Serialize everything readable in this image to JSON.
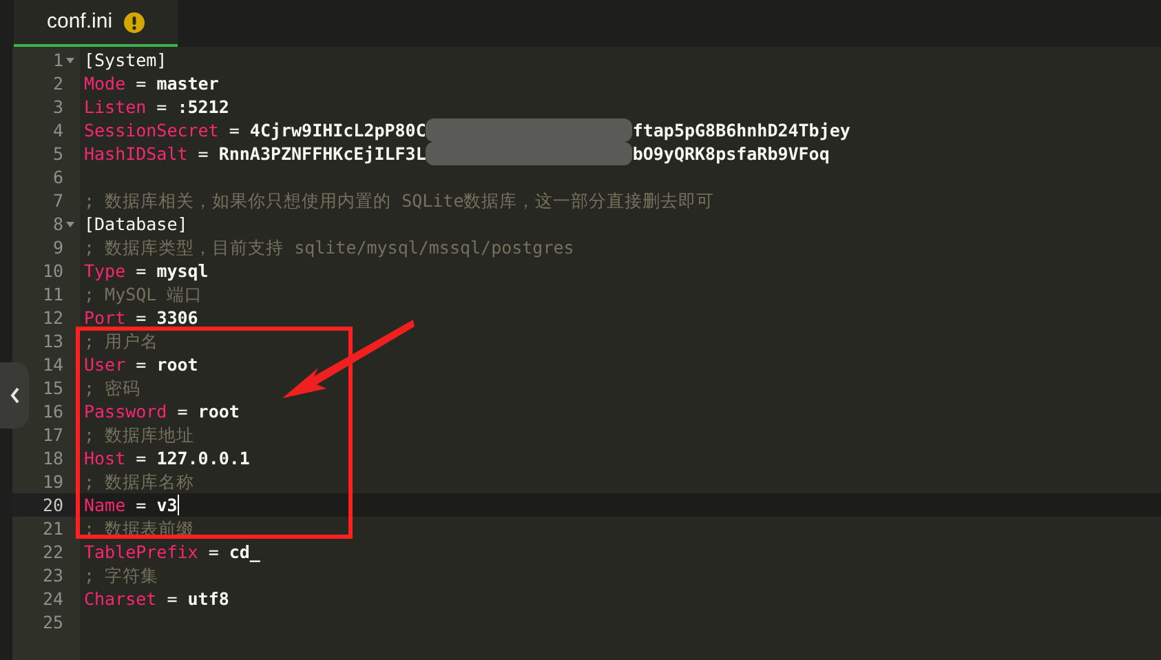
{
  "tabs": [
    {
      "label": "conf.ini",
      "selected": true,
      "warning": true
    }
  ],
  "lines": [
    {
      "number": "1",
      "kind": "section",
      "text": "[System]",
      "foldable": true,
      "active": false
    },
    {
      "number": "2",
      "kind": "pair",
      "key": "Mode",
      "sep": " = ",
      "value": "master",
      "active": false
    },
    {
      "number": "3",
      "kind": "pair",
      "key": "Listen",
      "sep": " = ",
      "value": ":5212",
      "active": false
    },
    {
      "number": "4",
      "kind": "pair",
      "key": "SessionSecret",
      "sep": " = ",
      "value": "4Cjrw9IHIcL2pP80C",
      "redacted": true,
      "value_after": "ftap5pG8B6hnhD24Tbjey",
      "active": false
    },
    {
      "number": "5",
      "kind": "pair",
      "key": "HashIDSalt",
      "sep": " = ",
      "value": "RnnA3PZNFFHKcEjILF3L",
      "redacted": true,
      "value_after": "bO9yQRK8psfaRb9VFoq",
      "active": false
    },
    {
      "number": "6",
      "kind": "blank",
      "active": false
    },
    {
      "number": "7",
      "kind": "comment",
      "text": "; 数据库相关，如果你只想使用内置的 SQLite数据库，这一部分直接删去即可",
      "active": false
    },
    {
      "number": "8",
      "kind": "section",
      "text": "[Database]",
      "foldable": true,
      "active": false
    },
    {
      "number": "9",
      "kind": "comment",
      "text": "; 数据库类型，目前支持 sqlite/mysql/mssql/postgres",
      "active": false
    },
    {
      "number": "10",
      "kind": "pair",
      "key": "Type",
      "sep": " = ",
      "value": "mysql",
      "active": false
    },
    {
      "number": "11",
      "kind": "comment",
      "text": "; MySQL 端口",
      "active": false
    },
    {
      "number": "12",
      "kind": "pair",
      "key": "Port",
      "sep": " = ",
      "value": "3306",
      "active": false
    },
    {
      "number": "13",
      "kind": "comment",
      "text": "; 用户名",
      "active": false
    },
    {
      "number": "14",
      "kind": "pair",
      "key": "User",
      "sep": " = ",
      "value": "root",
      "active": false
    },
    {
      "number": "15",
      "kind": "comment",
      "text": "; 密码",
      "active": false
    },
    {
      "number": "16",
      "kind": "pair",
      "key": "Password",
      "sep": " = ",
      "value": "root",
      "active": false
    },
    {
      "number": "17",
      "kind": "comment",
      "text": "; 数据库地址",
      "active": false
    },
    {
      "number": "18",
      "kind": "pair",
      "key": "Host",
      "sep": " = ",
      "value": "127.0.0.1",
      "active": false
    },
    {
      "number": "19",
      "kind": "comment",
      "text": "; 数据库名称",
      "active": false
    },
    {
      "number": "20",
      "kind": "pair",
      "key": "Name",
      "sep": " = ",
      "value": "v3",
      "active": true
    },
    {
      "number": "21",
      "kind": "comment",
      "text": "; 数据表前缀",
      "active": false
    },
    {
      "number": "22",
      "kind": "pair",
      "key": "TablePrefix",
      "sep": " = ",
      "value": "cd_",
      "active": false
    },
    {
      "number": "23",
      "kind": "comment",
      "text": "; 字符集",
      "active": false
    },
    {
      "number": "24",
      "kind": "pair",
      "key": "Charset",
      "sep": " = ",
      "value": "utf8",
      "active": false
    },
    {
      "number": "25",
      "kind": "blank",
      "active": false
    }
  ]
}
